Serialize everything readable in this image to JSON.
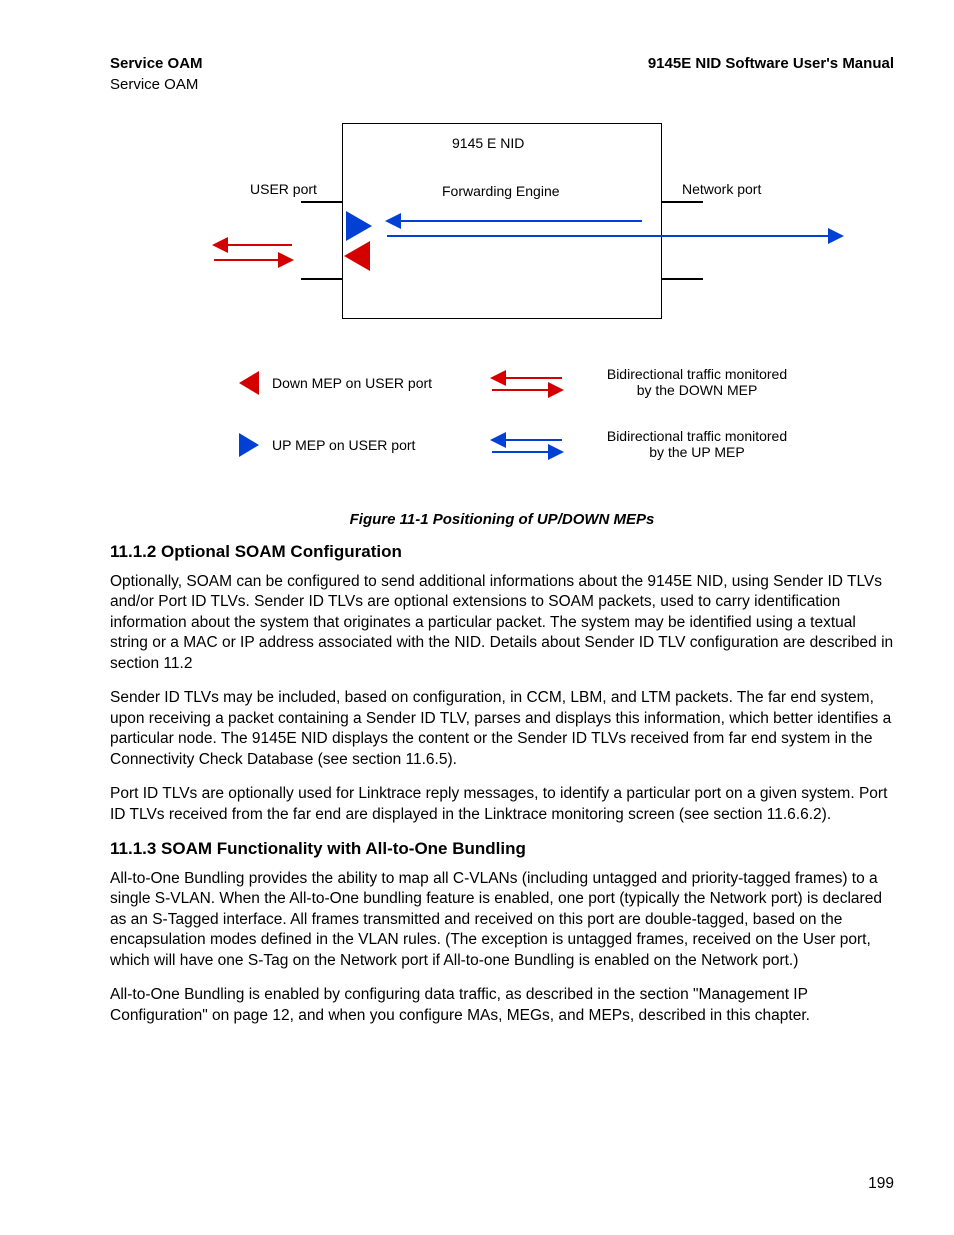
{
  "header": {
    "left_bold": "Service OAM",
    "right_bold": "9145E NID Software User's Manual",
    "sub_left": "Service OAM"
  },
  "diagram": {
    "title": "9145 E NID",
    "forwarding": "Forwarding Engine",
    "user_port": "USER port",
    "network_port": "Network port",
    "legend": {
      "down_mep": "Down MEP on USER port",
      "up_mep": "UP MEP on USER port",
      "bidir_down_l1": "Bidirectional traffic monitored",
      "bidir_down_l2": "by the DOWN MEP",
      "bidir_up_l1": "Bidirectional traffic monitored",
      "bidir_up_l2": "by the UP MEP"
    }
  },
  "figure_caption": "Figure 11-1  Positioning of UP/DOWN MEPs",
  "sections": {
    "s112": {
      "heading": "11.1.2  Optional SOAM Configuration",
      "p1": "Optionally, SOAM can be configured to send additional informations about the 9145E NID, using Sender ID TLVs and/or Port ID TLVs. Sender ID TLVs are optional extensions to SOAM packets, used to carry identification information about the system that originates a particular packet. The system may be identified using a textual string or a MAC or IP address associated with the NID. Details about Sender ID TLV configuration are described in section 11.2",
      "p2": "Sender ID TLVs may be included, based on configuration, in CCM, LBM, and LTM packets. The far end system, upon receiving a packet containing a Sender ID TLV, parses and displays this information, which better identifies a particular node. The 9145E NID displays the content or the Sender ID TLVs received from far end system in the Connectivity Check Database (see section 11.6.5).",
      "p3": "Port ID TLVs are optionally used for Linktrace reply messages, to identify a particular port on a given system. Port ID TLVs received from the far end are displayed in the Linktrace monitoring screen (see section 11.6.6.2)."
    },
    "s113": {
      "heading": "11.1.3  SOAM Functionality with All-to-One Bundling",
      "p1": "All-to-One Bundling provides the ability to map all C-VLANs (including untagged and priority-tagged frames) to a single S-VLAN. When the All-to-One bundling feature is enabled, one port (typically the Network port) is declared as an S-Tagged interface. All frames transmitted and received on this port are double-tagged, based on the encapsulation modes defined in the VLAN rules. (The exception is untagged frames, received on the User port, which will  have one S-Tag on the Network port if All-to-one Bundling is enabled on the Network port.)",
      "p2": "All-to-One Bundling is enabled by configuring data traffic, as described in the section \"Management IP Configuration\" on page 12, and when you configure MAs, MEGs, and MEPs, described in this chapter."
    }
  },
  "page_number": "199"
}
